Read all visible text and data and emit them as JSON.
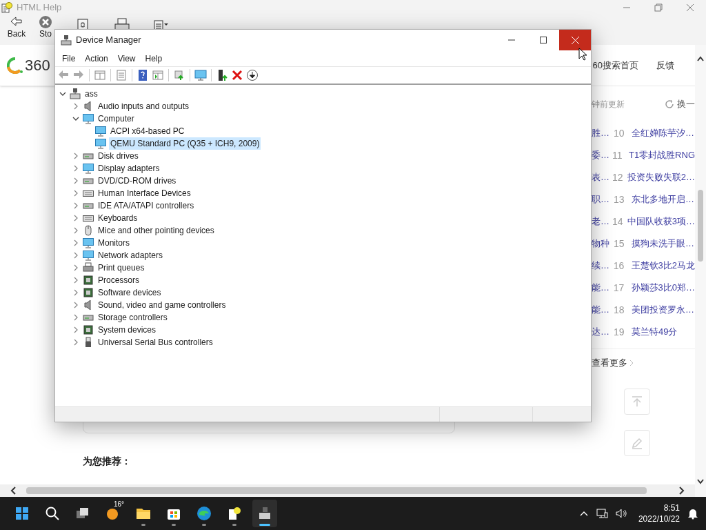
{
  "help_window": {
    "title": "HTML Help",
    "toolbar": [
      {
        "label": "Back"
      },
      {
        "label": "Sto"
      }
    ]
  },
  "web_page": {
    "logo_text": "360",
    "nav": [
      "60搜索首页",
      "反馈"
    ],
    "hot_list": {
      "update_note": "钟前更新",
      "refresh": "换一",
      "items": [
        {
          "left": "胜…",
          "rank": "10",
          "title": "全红婵陈芋汐…"
        },
        {
          "left": "委…",
          "rank": "11",
          "title": "T1零封战胜RNG"
        },
        {
          "left": "表…",
          "rank": "12",
          "title": "投资失败失联2…"
        },
        {
          "left": "职…",
          "rank": "13",
          "title": "东北多地开启…"
        },
        {
          "left": "老…",
          "rank": "14",
          "title": "中国队收获3项…"
        },
        {
          "left": "物种",
          "rank": "15",
          "title": "摸狗未洗手眼…"
        },
        {
          "left": "续…",
          "rank": "16",
          "title": "王楚钦3比2马龙"
        },
        {
          "left": "能…",
          "rank": "17",
          "title": "孙颖莎3比0郑…"
        },
        {
          "left": "能…",
          "rank": "18",
          "title": "美团投资罗永…"
        },
        {
          "left": "达…",
          "rank": "19",
          "title": "莫兰特49分"
        }
      ],
      "more": "查看更多"
    },
    "recommend_heading": "为您推荐："
  },
  "device_manager": {
    "title": "Device Manager",
    "close_hovered": true,
    "menu": [
      "File",
      "Action",
      "View",
      "Help"
    ],
    "tree": [
      {
        "label": "ass",
        "expanded": true,
        "selected": false,
        "children": [
          {
            "label": "Audio inputs and outputs",
            "expanded": false,
            "selected": false
          },
          {
            "label": "Computer",
            "expanded": true,
            "selected": false,
            "children": [
              {
                "label": "ACPI x64-based PC",
                "selected": false
              },
              {
                "label": "QEMU Standard PC (Q35 + ICH9, 2009)",
                "selected": true
              }
            ]
          },
          {
            "label": "Disk drives",
            "expanded": false,
            "selected": false
          },
          {
            "label": "Display adapters",
            "expanded": false,
            "selected": false
          },
          {
            "label": "DVD/CD-ROM drives",
            "expanded": false,
            "selected": false
          },
          {
            "label": "Human Interface Devices",
            "expanded": false,
            "selected": false
          },
          {
            "label": "IDE ATA/ATAPI controllers",
            "expanded": false,
            "selected": false
          },
          {
            "label": "Keyboards",
            "expanded": false,
            "selected": false
          },
          {
            "label": "Mice and other pointing devices",
            "expanded": false,
            "selected": false
          },
          {
            "label": "Monitors",
            "expanded": false,
            "selected": false
          },
          {
            "label": "Network adapters",
            "expanded": false,
            "selected": false
          },
          {
            "label": "Print queues",
            "expanded": false,
            "selected": false
          },
          {
            "label": "Processors",
            "expanded": false,
            "selected": false
          },
          {
            "label": "Software devices",
            "expanded": false,
            "selected": false
          },
          {
            "label": "Sound, video and game controllers",
            "expanded": false,
            "selected": false
          },
          {
            "label": "Storage controllers",
            "expanded": false,
            "selected": false
          },
          {
            "label": "System devices",
            "expanded": false,
            "selected": false
          },
          {
            "label": "Universal Serial Bus controllers",
            "expanded": false,
            "selected": false
          }
        ]
      }
    ]
  },
  "taskbar": {
    "weather": "16°",
    "apps": [
      {
        "selected": false
      },
      {
        "selected": false
      },
      {
        "selected": false
      },
      {
        "selected": false
      },
      {
        "selected": false
      },
      {
        "selected": false
      },
      {
        "selected": false
      },
      {
        "selected": true
      }
    ],
    "time": "8:51",
    "date": "2022/10/22"
  }
}
